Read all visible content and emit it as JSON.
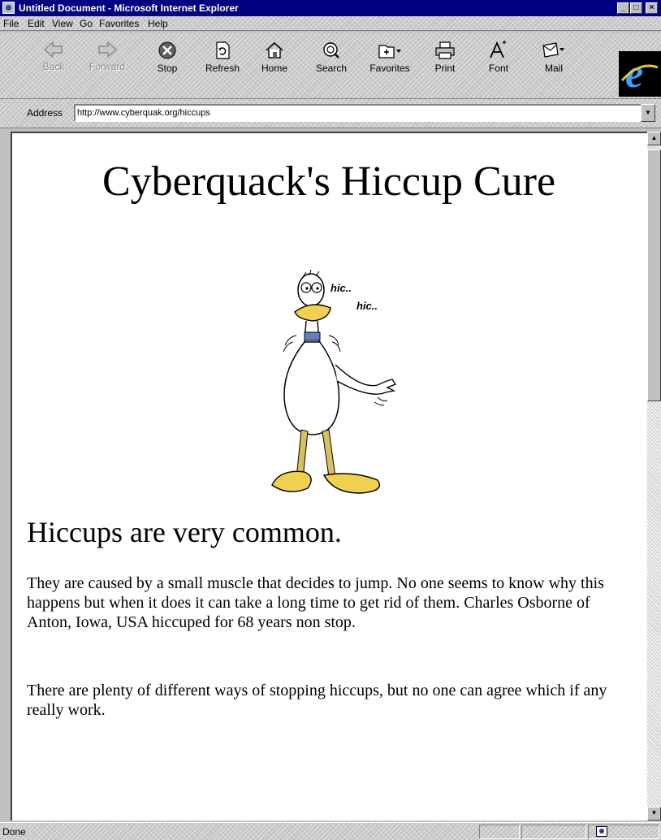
{
  "window": {
    "title": "Untitled Document - Microsoft Internet Explorer"
  },
  "menu": [
    "File",
    "Edit",
    "View",
    "Go",
    "Favorites",
    "Help"
  ],
  "toolbar": {
    "buttons": [
      {
        "label": "Back",
        "icon": "back-arrow-icon",
        "enabled": false
      },
      {
        "label": "Forward",
        "icon": "forward-arrow-icon",
        "enabled": false
      },
      {
        "label": "Stop",
        "icon": "stop-icon",
        "enabled": true
      },
      {
        "label": "Refresh",
        "icon": "refresh-icon",
        "enabled": true
      },
      {
        "label": "Home",
        "icon": "home-icon",
        "enabled": true
      },
      {
        "label": "Search",
        "icon": "search-globe-icon",
        "enabled": true
      },
      {
        "label": "Favorites",
        "icon": "favorites-folder-icon",
        "enabled": true
      },
      {
        "label": "Print",
        "icon": "printer-icon",
        "enabled": true
      },
      {
        "label": "Font",
        "icon": "font-icon",
        "enabled": true
      },
      {
        "label": "Mail",
        "icon": "mail-icon",
        "enabled": true
      }
    ],
    "brand_icon": "internet-explorer-logo-icon"
  },
  "address": {
    "label": "Address",
    "url": "http://www.cyberquak.org/hiccups"
  },
  "page": {
    "title": "Cyberquack's Hiccup Cure",
    "image": {
      "icon": "hiccuping-duck-illustration",
      "hic1": "hic..",
      "hic2": "hic.."
    },
    "heading": "Hiccups are very common.",
    "paragraphs": [
      "They are caused by a small muscle that decides to jump. No one seems to know why this happens but when it does it can take a long time to get rid of them. Charles Osborne of Anton, Iowa, USA hiccuped for 68 years non stop.",
      "There are plenty of different ways of stopping hiccups, but no one can agree which if any really work."
    ]
  },
  "status": {
    "text": "Done"
  },
  "colors": {
    "titlebar": "#000080",
    "chrome": "#c0c0c0",
    "duck_feet": "#f0d050",
    "duck_collar": "#6080c0"
  }
}
